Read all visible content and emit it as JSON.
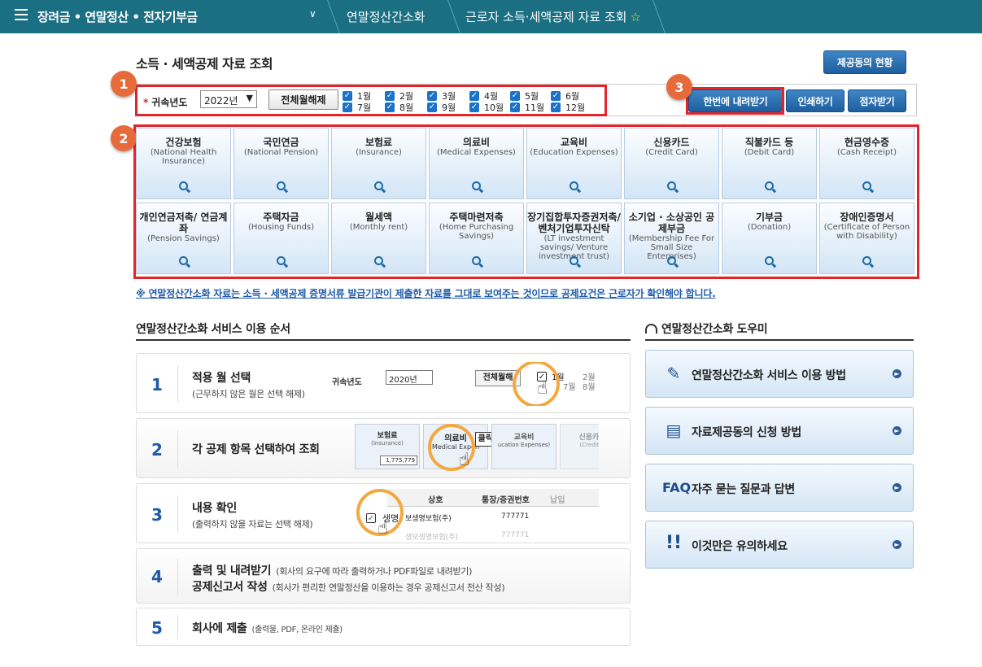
{
  "topbar": {
    "menu_title": "장려금 • 연말정산 • 전자기부금",
    "dropdown_icon": "chevron-down",
    "crumb1": "연말정산간소화",
    "crumb2": "근로자 소득·세액공제 자료 조회",
    "star": "☆"
  },
  "page_title": "소득 · 세액공제 자료 조회",
  "buttons": {
    "provider_status": "제공동의 현황",
    "download_all": "한번에 내려받기",
    "print": "인쇄하기",
    "braille": "점자받기",
    "deselect_all": "전체월해제"
  },
  "filter": {
    "required_mark": "*",
    "year_label": "귀속년도",
    "year_value": "2022년",
    "months": [
      "1월",
      "2월",
      "3월",
      "4월",
      "5월",
      "6월",
      "7월",
      "8월",
      "9월",
      "10월",
      "11월",
      "12월"
    ]
  },
  "badges": [
    "1",
    "2",
    "3"
  ],
  "categories": [
    {
      "ko": "건강보험",
      "en": "(National Health Insurance)"
    },
    {
      "ko": "국민연금",
      "en": "(National Pension)"
    },
    {
      "ko": "보험료",
      "en": "(Insurance)"
    },
    {
      "ko": "의료비",
      "en": "(Medical Expenses)"
    },
    {
      "ko": "교육비",
      "en": "(Education Expenses)"
    },
    {
      "ko": "신용카드",
      "en": "(Credit Card)"
    },
    {
      "ko": "직불카드 등",
      "en": "(Debit Card)"
    },
    {
      "ko": "현금영수증",
      "en": "(Cash Receipt)"
    },
    {
      "ko": "개인연금저축/ 연금계좌",
      "en": "(Pension Savings)"
    },
    {
      "ko": "주택자금",
      "en": "(Housing Funds)"
    },
    {
      "ko": "월세액",
      "en": "(Monthly rent)"
    },
    {
      "ko": "주택마련저축",
      "en": "(Home Purchasing Savings)"
    },
    {
      "ko": "장기집합투자증권저축/ 벤처기업투자신탁",
      "en": "(LT investment savings/ Venture investment trust)"
    },
    {
      "ko": "소기업 · 소상공인 공제부금",
      "en": "(Membership Fee For Small Size Enterprises)"
    },
    {
      "ko": "기부금",
      "en": "(Donation)"
    },
    {
      "ko": "장애인증명서",
      "en": "(Certificate of Person with Disability)"
    }
  ],
  "notice": "※ 연말정산간소화 자료는 소득 · 세액공제 증명서류 발급기관이 제출한 자료를 그대로 보여주는 것이므로 공제요건은 근로자가 확인해야 합니다.",
  "steps_title": "연말정산간소화 서비스 이용 순서",
  "steps": [
    {
      "num": "1",
      "title": "적용 월 선택",
      "sub": "(근무하지 않은 월은 선택 해제)"
    },
    {
      "num": "2",
      "title": "각 공제 항목 선택하여 조회",
      "sub": ""
    },
    {
      "num": "3",
      "title": "내용 확인",
      "sub": "(출력하지 않을 자료는 선택 해제)"
    },
    {
      "num": "4",
      "title": "출력 및 내려받기",
      "sub": "(회사의 요구에 따라 출력하거나 PDF파일로 내려받기)",
      "title2": "공제신고서 작성",
      "sub2": "(회사가 편리한 연말정산을 이용하는 경우 공제신고서 전산 작성)"
    },
    {
      "num": "5",
      "title": "회사에 제출",
      "sub": "(출력물, PDF, 온라인 제출)"
    }
  ],
  "illus1": {
    "label": "귀속년도",
    "year": "2020년",
    "btn": "전체월해",
    "m1": "1월",
    "m2": "2월",
    "m7": "7월",
    "m8": "8월"
  },
  "illus2": {
    "t1": "보험료",
    "t1en": "(Insurance)",
    "amount": "1,775,779",
    "t2": "의료비",
    "t2en": "Medical Expen",
    "click": "클릭!",
    "t3": "교육비",
    "t3en": "ucation Expenses)",
    "t4": "신용카드",
    "t4en": "(Credit C"
  },
  "illus3": {
    "col1": "상호",
    "col2": "통장/증권번호",
    "col3": "납입",
    "name": "생명",
    "company": "보생명보험(주)",
    "acct": "777771",
    "company2": "생보생명보험(주)",
    "acct2": "777771"
  },
  "helper_title": "연말정산간소화 도우미",
  "helpers": [
    {
      "icon": "document-pen-icon",
      "label": "연말정산간소화 서비스 이용 방법"
    },
    {
      "icon": "form-icon",
      "label": "자료제공동의 신청 방법"
    },
    {
      "icon": "faq-icon",
      "label": "자주 묻는 질문과 답변"
    },
    {
      "icon": "exclamation-icon",
      "label": "이것만은 유의하세요"
    }
  ]
}
